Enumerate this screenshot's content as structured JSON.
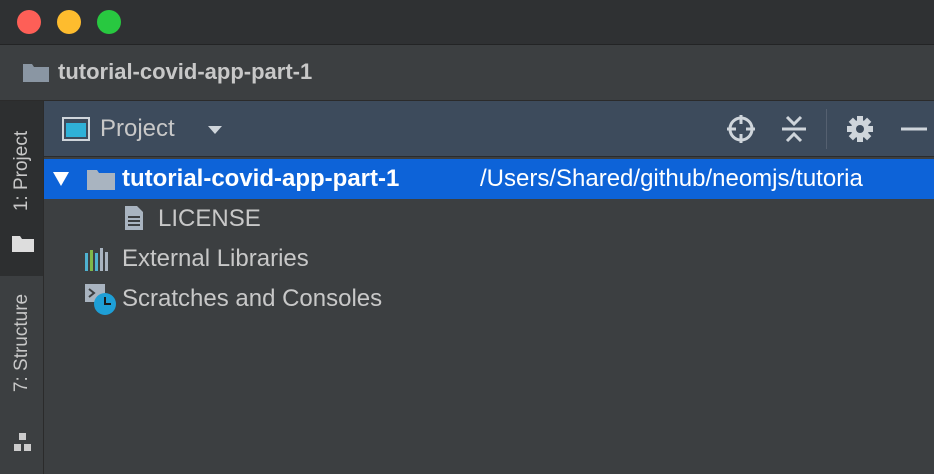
{
  "window": {
    "title": "tutorial-covid-app-part-1"
  },
  "side_tabs": [
    {
      "label": "1: Project",
      "active": true
    },
    {
      "label": "7: Structure",
      "active": false
    }
  ],
  "panel": {
    "title": "Project",
    "icons": [
      "locate-icon",
      "collapse-all-icon",
      "gear-icon",
      "minimize-icon"
    ]
  },
  "tree": {
    "root": {
      "name": "tutorial-covid-app-part-1",
      "path": "/Users/Shared/github/neomjs/tutoria"
    },
    "file": {
      "name": "LICENSE"
    },
    "external": {
      "label": "External Libraries"
    },
    "scratches": {
      "label": "Scratches and Consoles"
    }
  },
  "colors": {
    "selection": "#0d63d8",
    "header": "#3d4b5c",
    "background": "#3c3f41"
  }
}
